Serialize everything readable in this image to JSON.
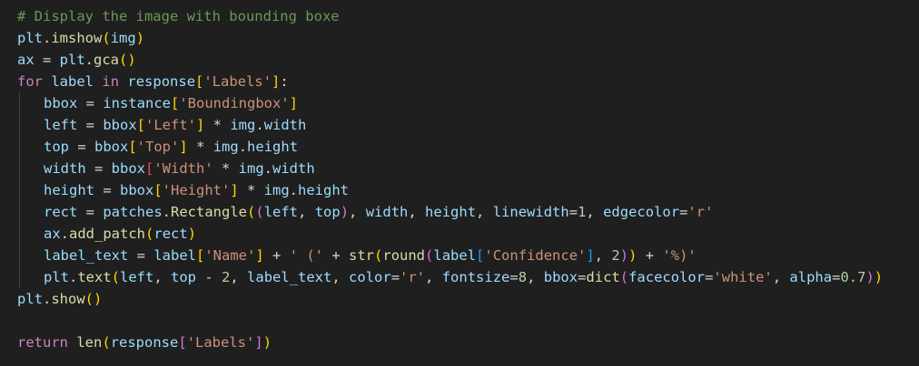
{
  "editor": {
    "theme": {
      "background": "#1f1f1f",
      "comment": "#6a9955",
      "default": "#d4d4d4",
      "variable": "#9cdcfe",
      "function": "#dcdcaa",
      "keyword": "#c586c0",
      "string": "#ce9178",
      "number": "#b5cea8",
      "bracket_level_1": "#ffd700",
      "bracket_level_2": "#da70d6",
      "bracket_level_3": "#179fff"
    },
    "lines": [
      {
        "indent": 0,
        "tokens": [
          {
            "t": "comment",
            "v": "# Display the image with bounding boxe"
          }
        ]
      },
      {
        "indent": 0,
        "tokens": [
          {
            "t": "var",
            "v": "plt"
          },
          {
            "t": "default",
            "v": "."
          },
          {
            "t": "fn",
            "v": "imshow"
          },
          {
            "t": "b1",
            "v": "("
          },
          {
            "t": "var",
            "v": "img"
          },
          {
            "t": "b1",
            "v": ")"
          }
        ]
      },
      {
        "indent": 0,
        "tokens": [
          {
            "t": "var",
            "v": "ax"
          },
          {
            "t": "default",
            "v": " = "
          },
          {
            "t": "var",
            "v": "plt"
          },
          {
            "t": "default",
            "v": "."
          },
          {
            "t": "fn",
            "v": "gca"
          },
          {
            "t": "b1",
            "v": "()"
          }
        ]
      },
      {
        "indent": 0,
        "tokens": [
          {
            "t": "kw",
            "v": "for"
          },
          {
            "t": "default",
            "v": " "
          },
          {
            "t": "var",
            "v": "label"
          },
          {
            "t": "default",
            "v": " "
          },
          {
            "t": "kw",
            "v": "in"
          },
          {
            "t": "default",
            "v": " "
          },
          {
            "t": "var",
            "v": "response"
          },
          {
            "t": "b1",
            "v": "["
          },
          {
            "t": "str",
            "v": "'Labels'"
          },
          {
            "t": "b1",
            "v": "]"
          },
          {
            "t": "default",
            "v": ":"
          }
        ]
      },
      {
        "indent": 1,
        "tokens": [
          {
            "t": "var",
            "v": "bbox"
          },
          {
            "t": "default",
            "v": " = "
          },
          {
            "t": "var",
            "v": "instance"
          },
          {
            "t": "b1",
            "v": "["
          },
          {
            "t": "str",
            "v": "'Boundingbox'"
          },
          {
            "t": "b1",
            "v": "]"
          }
        ]
      },
      {
        "indent": 1,
        "tokens": [
          {
            "t": "var",
            "v": "left"
          },
          {
            "t": "default",
            "v": " = "
          },
          {
            "t": "var",
            "v": "bbox"
          },
          {
            "t": "b1",
            "v": "["
          },
          {
            "t": "str",
            "v": "'Left'"
          },
          {
            "t": "b1",
            "v": "]"
          },
          {
            "t": "default",
            "v": " * "
          },
          {
            "t": "var",
            "v": "img"
          },
          {
            "t": "default",
            "v": "."
          },
          {
            "t": "var",
            "v": "width"
          }
        ]
      },
      {
        "indent": 1,
        "tokens": [
          {
            "t": "var",
            "v": "top"
          },
          {
            "t": "default",
            "v": " = "
          },
          {
            "t": "var",
            "v": "bbox"
          },
          {
            "t": "b1",
            "v": "["
          },
          {
            "t": "str",
            "v": "'Top'"
          },
          {
            "t": "b1",
            "v": "]"
          },
          {
            "t": "default",
            "v": " * "
          },
          {
            "t": "var",
            "v": "img"
          },
          {
            "t": "default",
            "v": "."
          },
          {
            "t": "var",
            "v": "height"
          }
        ]
      },
      {
        "indent": 1,
        "tokens": [
          {
            "t": "var",
            "v": "width"
          },
          {
            "t": "default",
            "v": " = "
          },
          {
            "t": "var",
            "v": "bbox"
          },
          {
            "t": "err",
            "v": "["
          },
          {
            "t": "str",
            "v": "'Width'"
          },
          {
            "t": "default",
            "v": " * "
          },
          {
            "t": "var",
            "v": "img"
          },
          {
            "t": "default",
            "v": "."
          },
          {
            "t": "var",
            "v": "width"
          }
        ]
      },
      {
        "indent": 1,
        "tokens": [
          {
            "t": "var",
            "v": "height"
          },
          {
            "t": "default",
            "v": " = "
          },
          {
            "t": "var",
            "v": "bbox"
          },
          {
            "t": "b1",
            "v": "["
          },
          {
            "t": "str",
            "v": "'Height'"
          },
          {
            "t": "b1",
            "v": "]"
          },
          {
            "t": "default",
            "v": " * "
          },
          {
            "t": "var",
            "v": "img"
          },
          {
            "t": "default",
            "v": "."
          },
          {
            "t": "var",
            "v": "height"
          }
        ]
      },
      {
        "indent": 1,
        "tokens": [
          {
            "t": "var",
            "v": "rect"
          },
          {
            "t": "default",
            "v": " = "
          },
          {
            "t": "var",
            "v": "patches"
          },
          {
            "t": "default",
            "v": "."
          },
          {
            "t": "fn",
            "v": "Rectangle"
          },
          {
            "t": "b1",
            "v": "("
          },
          {
            "t": "b2",
            "v": "("
          },
          {
            "t": "var",
            "v": "left"
          },
          {
            "t": "default",
            "v": ", "
          },
          {
            "t": "var",
            "v": "top"
          },
          {
            "t": "b2",
            "v": ")"
          },
          {
            "t": "default",
            "v": ", "
          },
          {
            "t": "var",
            "v": "width"
          },
          {
            "t": "default",
            "v": ", "
          },
          {
            "t": "var",
            "v": "height"
          },
          {
            "t": "default",
            "v": ", "
          },
          {
            "t": "var",
            "v": "linewidth"
          },
          {
            "t": "default",
            "v": "="
          },
          {
            "t": "num",
            "v": "1"
          },
          {
            "t": "default",
            "v": ", "
          },
          {
            "t": "var",
            "v": "edgecolor"
          },
          {
            "t": "default",
            "v": "="
          },
          {
            "t": "str",
            "v": "'r'"
          }
        ]
      },
      {
        "indent": 1,
        "tokens": [
          {
            "t": "var",
            "v": "ax"
          },
          {
            "t": "default",
            "v": "."
          },
          {
            "t": "fn",
            "v": "add_patch"
          },
          {
            "t": "b1",
            "v": "("
          },
          {
            "t": "var",
            "v": "rect"
          },
          {
            "t": "b1",
            "v": ")"
          }
        ]
      },
      {
        "indent": 1,
        "tokens": [
          {
            "t": "var",
            "v": "label_text"
          },
          {
            "t": "default",
            "v": " = "
          },
          {
            "t": "var",
            "v": "label"
          },
          {
            "t": "b1",
            "v": "["
          },
          {
            "t": "str",
            "v": "'Name'"
          },
          {
            "t": "b1",
            "v": "]"
          },
          {
            "t": "default",
            "v": " + "
          },
          {
            "t": "str",
            "v": "' ('"
          },
          {
            "t": "default",
            "v": " + "
          },
          {
            "t": "fn",
            "v": "str"
          },
          {
            "t": "b1",
            "v": "("
          },
          {
            "t": "fn",
            "v": "round"
          },
          {
            "t": "b2",
            "v": "("
          },
          {
            "t": "var",
            "v": "label"
          },
          {
            "t": "b3",
            "v": "["
          },
          {
            "t": "str",
            "v": "'Confidence'"
          },
          {
            "t": "b3",
            "v": "]"
          },
          {
            "t": "default",
            "v": ", "
          },
          {
            "t": "num",
            "v": "2"
          },
          {
            "t": "b2",
            "v": ")"
          },
          {
            "t": "b1",
            "v": ")"
          },
          {
            "t": "default",
            "v": " + "
          },
          {
            "t": "str",
            "v": "'%)'"
          }
        ]
      },
      {
        "indent": 1,
        "tokens": [
          {
            "t": "var",
            "v": "plt"
          },
          {
            "t": "default",
            "v": "."
          },
          {
            "t": "fn",
            "v": "text"
          },
          {
            "t": "b1",
            "v": "("
          },
          {
            "t": "var",
            "v": "left"
          },
          {
            "t": "default",
            "v": ", "
          },
          {
            "t": "var",
            "v": "top"
          },
          {
            "t": "default",
            "v": " - "
          },
          {
            "t": "num",
            "v": "2"
          },
          {
            "t": "default",
            "v": ", "
          },
          {
            "t": "var",
            "v": "label_text"
          },
          {
            "t": "default",
            "v": ", "
          },
          {
            "t": "var",
            "v": "color"
          },
          {
            "t": "default",
            "v": "="
          },
          {
            "t": "str",
            "v": "'r'"
          },
          {
            "t": "default",
            "v": ", "
          },
          {
            "t": "var",
            "v": "fontsize"
          },
          {
            "t": "default",
            "v": "="
          },
          {
            "t": "num",
            "v": "8"
          },
          {
            "t": "default",
            "v": ", "
          },
          {
            "t": "var",
            "v": "bbox"
          },
          {
            "t": "default",
            "v": "="
          },
          {
            "t": "fn",
            "v": "dict"
          },
          {
            "t": "b2",
            "v": "("
          },
          {
            "t": "var",
            "v": "facecolor"
          },
          {
            "t": "default",
            "v": "="
          },
          {
            "t": "str",
            "v": "'white'"
          },
          {
            "t": "default",
            "v": ", "
          },
          {
            "t": "var",
            "v": "alpha"
          },
          {
            "t": "default",
            "v": "="
          },
          {
            "t": "num",
            "v": "0.7"
          },
          {
            "t": "b2",
            "v": ")"
          },
          {
            "t": "b1",
            "v": ")"
          }
        ]
      },
      {
        "indent": 0,
        "tokens": [
          {
            "t": "var",
            "v": "plt"
          },
          {
            "t": "default",
            "v": "."
          },
          {
            "t": "fn",
            "v": "show"
          },
          {
            "t": "b1",
            "v": "()"
          }
        ]
      },
      {
        "indent": 0,
        "tokens": []
      },
      {
        "indent": 0,
        "tokens": [
          {
            "t": "kw",
            "v": "return"
          },
          {
            "t": "default",
            "v": " "
          },
          {
            "t": "fn",
            "v": "len"
          },
          {
            "t": "b1",
            "v": "("
          },
          {
            "t": "var",
            "v": "response"
          },
          {
            "t": "b2",
            "v": "["
          },
          {
            "t": "str",
            "v": "'Labels'"
          },
          {
            "t": "b2",
            "v": "]"
          },
          {
            "t": "b1",
            "v": ")"
          }
        ]
      }
    ]
  }
}
